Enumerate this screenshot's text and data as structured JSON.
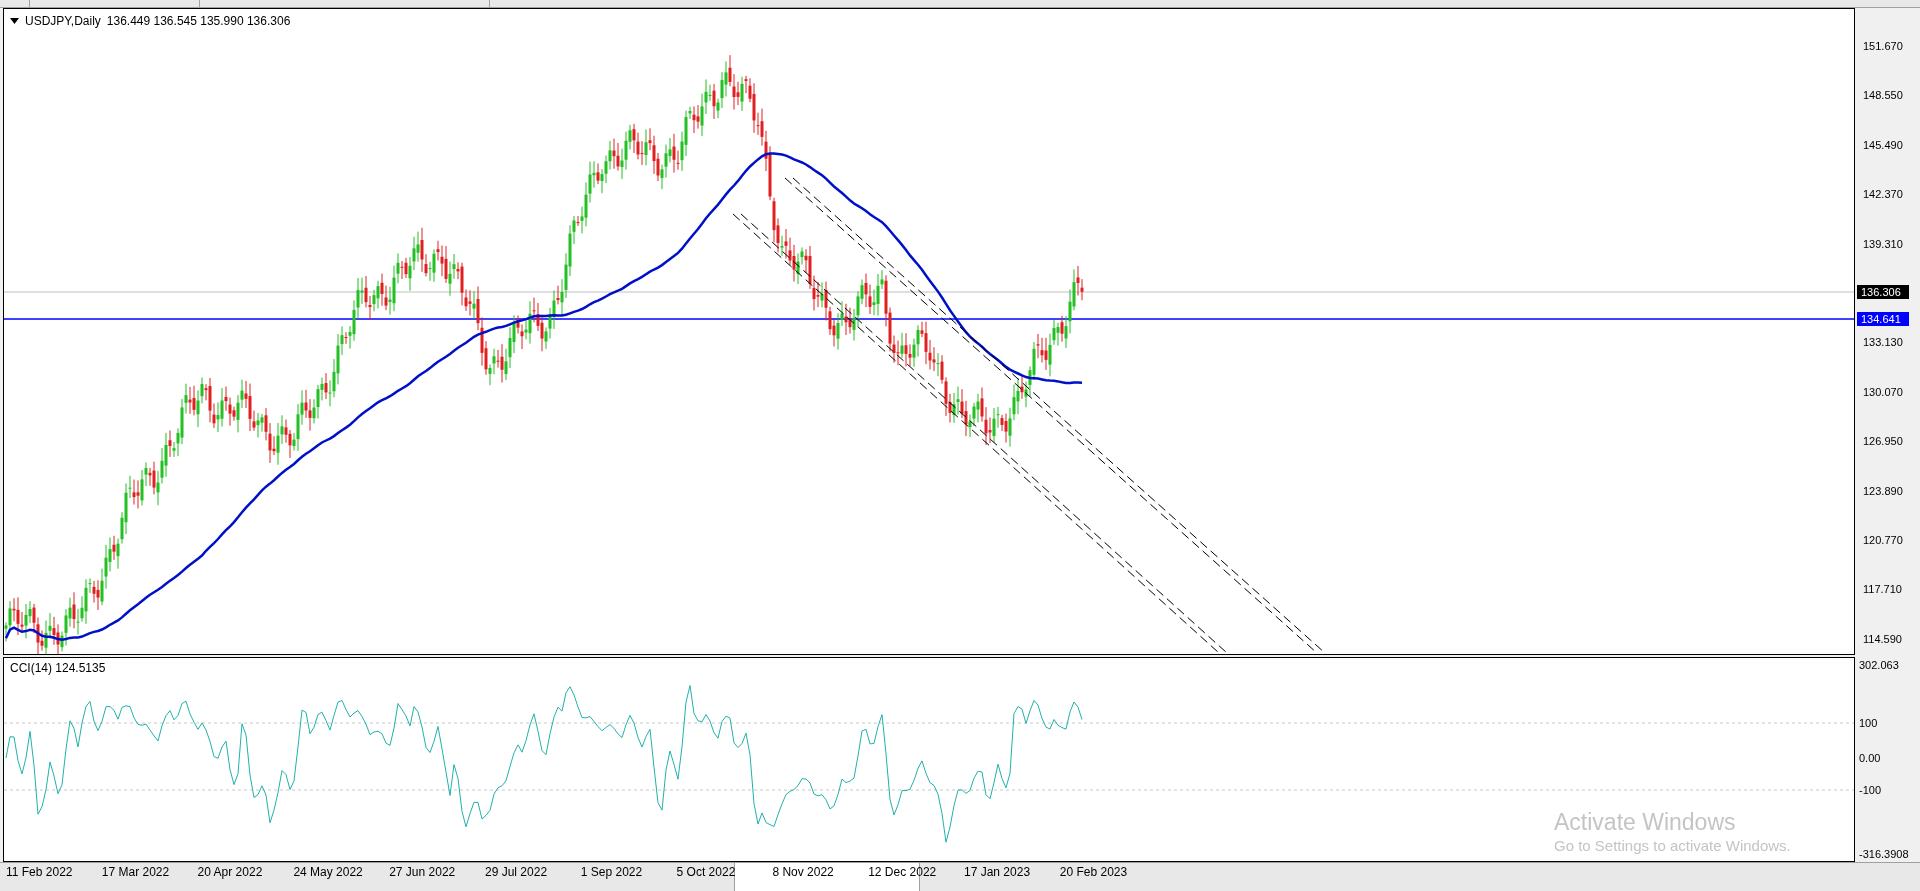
{
  "chart_header": {
    "symbol": "USDJPY,Daily",
    "ohlc": "136.449 136.545 135.990 136.306"
  },
  "price_axis": {
    "ticks": [
      "151.670",
      "148.550",
      "145.490",
      "142.370",
      "139.310",
      "133.130",
      "130.070",
      "126.950",
      "123.890",
      "120.770",
      "117.710",
      "114.590"
    ],
    "bid_tag": "136.306",
    "line_tag": "134.641"
  },
  "indicator": {
    "header": "CCI(14) 124.5135",
    "axis_ticks": [
      "302.063",
      "100",
      "0.00",
      "-100",
      "-316.3908"
    ]
  },
  "date_axis": [
    "11 Feb 2022",
    "17 Mar 2022",
    "20 Apr 2022",
    "24 May 2022",
    "27 Jun 2022",
    "29 Jul 2022",
    "1 Sep 2022",
    "5 Oct 2022",
    "8 Nov 2022",
    "12 Dec 2022",
    "17 Jan 2023",
    "20 Feb 2023"
  ],
  "os_notice": {
    "title": "Activate Windows",
    "subtitle": "Go to Settings to activate Windows."
  }
}
